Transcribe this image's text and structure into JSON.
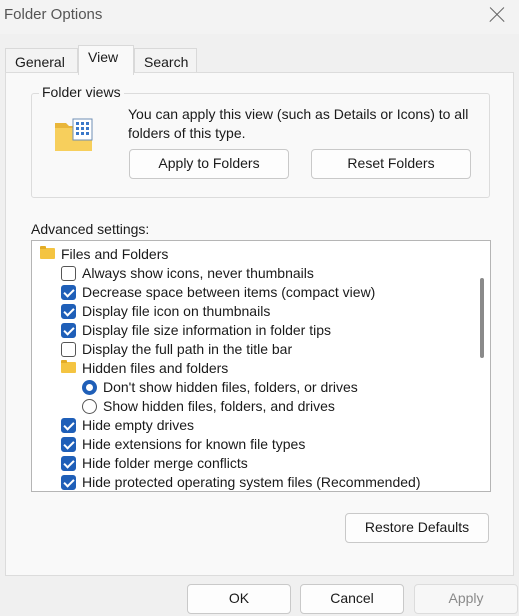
{
  "window": {
    "title": "Folder Options"
  },
  "tabs": [
    {
      "label": "General",
      "active": false
    },
    {
      "label": "View",
      "active": true
    },
    {
      "label": "Search",
      "active": false
    }
  ],
  "folder_views": {
    "title": "Folder views",
    "description": "You can apply this view (such as Details or Icons) to all folders of this type.",
    "apply_label": "Apply to Folders",
    "reset_label": "Reset Folders"
  },
  "advanced": {
    "label": "Advanced settings:",
    "items": [
      {
        "type": "folder",
        "indent": 0,
        "label": "Files and Folders"
      },
      {
        "type": "checkbox",
        "indent": 1,
        "checked": false,
        "label": "Always show icons, never thumbnails"
      },
      {
        "type": "checkbox",
        "indent": 1,
        "checked": true,
        "label": "Decrease space between items (compact view)"
      },
      {
        "type": "checkbox",
        "indent": 1,
        "checked": true,
        "label": "Display file icon on thumbnails"
      },
      {
        "type": "checkbox",
        "indent": 1,
        "checked": true,
        "label": "Display file size information in folder tips"
      },
      {
        "type": "checkbox",
        "indent": 1,
        "checked": false,
        "label": "Display the full path in the title bar"
      },
      {
        "type": "folder",
        "indent": 1,
        "label": "Hidden files and folders"
      },
      {
        "type": "radio",
        "indent": 2,
        "checked": true,
        "label": "Don't show hidden files, folders, or drives"
      },
      {
        "type": "radio",
        "indent": 2,
        "checked": false,
        "label": "Show hidden files, folders, and drives"
      },
      {
        "type": "checkbox",
        "indent": 1,
        "checked": true,
        "label": "Hide empty drives"
      },
      {
        "type": "checkbox",
        "indent": 1,
        "checked": true,
        "label": "Hide extensions for known file types"
      },
      {
        "type": "checkbox",
        "indent": 1,
        "checked": true,
        "label": "Hide folder merge conflicts"
      },
      {
        "type": "checkbox",
        "indent": 1,
        "checked": true,
        "label": "Hide protected operating system files (Recommended)"
      }
    ],
    "restore_label": "Restore Defaults"
  },
  "footer": {
    "ok_label": "OK",
    "cancel_label": "Cancel",
    "apply_label": "Apply"
  },
  "colors": {
    "accent": "#1f5fb8",
    "folder": "#f4c441"
  }
}
